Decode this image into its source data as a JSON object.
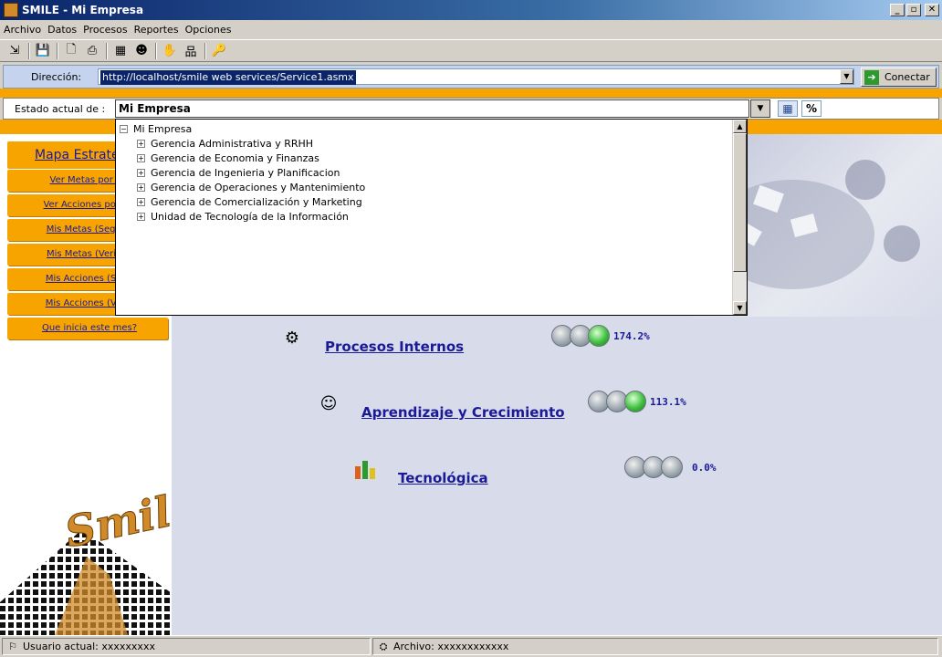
{
  "window": {
    "title": "SMILE - Mi Empresa",
    "min": "_",
    "max": "▫",
    "close": "✕"
  },
  "menu": [
    "Archivo",
    "Datos",
    "Procesos",
    "Reportes",
    "Opciones"
  ],
  "toolbar": [
    "exit-icon",
    "save-icon",
    "preview-icon",
    "print-icon",
    "chart-icon",
    "users-icon",
    "handshake-icon",
    "orgchart-icon",
    "key-icon"
  ],
  "address": {
    "label": "Dirección:",
    "url": "http://localhost/smile web services/Service1.asmx",
    "connect_label": "Conectar"
  },
  "estado": {
    "label": "Estado actual de :",
    "selected": "Mi Empresa",
    "percent": "%"
  },
  "tree": {
    "root": "Mi Empresa",
    "children": [
      "Gerencia Administrativa y RRHH",
      "Gerencia de Economia y Finanzas",
      "Gerencia de Ingenieria y Planificacion",
      "Gerencia de Operaciones y Mantenimiento",
      "Gerencia de Comercialización y Marketing",
      "Unidad de Tecnología de la Información"
    ]
  },
  "sidebar": {
    "title": "Mapa Estraté",
    "items": [
      "Ver Metas por alc",
      "Ver Acciones por alc",
      "Mis Metas (Seguim",
      "Mis Metas (Verifica",
      "Mis Acciones (Segu",
      "Mis Acciones (Verifi",
      "Que inicia este mes?"
    ]
  },
  "perspectives": [
    {
      "name": "Procesos Internos",
      "value": "174.2%",
      "lights": [
        "gray",
        "gray",
        "green"
      ]
    },
    {
      "name": "Aprendizaje y Crecimiento",
      "value": "113.1%",
      "lights": [
        "gray",
        "gray",
        "green"
      ]
    },
    {
      "name": "Tecnológica",
      "value": "0.0%",
      "lights": [
        "gray",
        "gray",
        "gray"
      ]
    }
  ],
  "logo": {
    "text": "Smile"
  },
  "status": {
    "user": "Usuario actual: xxxxxxxxx",
    "file": "Archivo: xxxxxxxxxxxx"
  },
  "colors": {
    "accent_orange": "#f7a400",
    "link_blue": "#1a1a99",
    "title_blue": "#0a246a"
  }
}
